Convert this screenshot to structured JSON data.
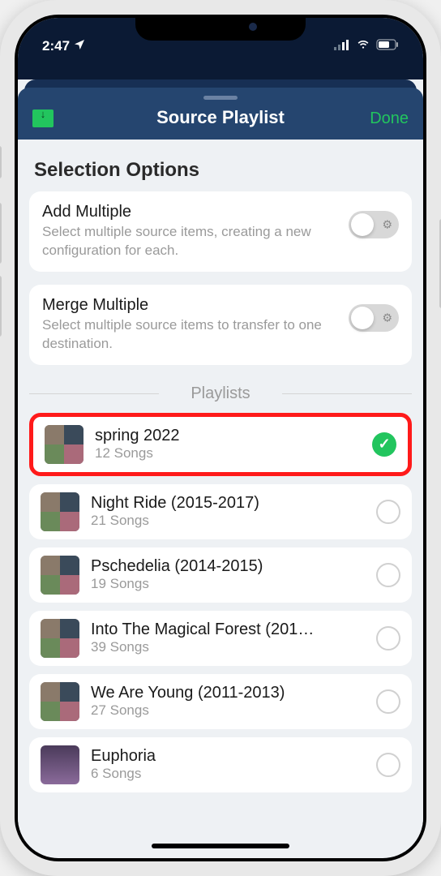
{
  "status": {
    "time": "2:47",
    "location_icon": "location-arrow"
  },
  "nav": {
    "title": "Source Playlist",
    "done": "Done"
  },
  "section_title": "Selection Options",
  "options": {
    "add": {
      "title": "Add Multiple",
      "desc": "Select multiple source items, creating a new configuration for each."
    },
    "merge": {
      "title": "Merge Multiple",
      "desc": "Select multiple source items to transfer to one destination."
    }
  },
  "playlists_header": "Playlists",
  "playlists": [
    {
      "name": "spring 2022",
      "sub": "12 Songs",
      "selected": true,
      "highlighted": true
    },
    {
      "name": "Night Ride (2015-2017)",
      "sub": "21 Songs",
      "selected": false
    },
    {
      "name": "Pschedelia (2014-2015)",
      "sub": "19 Songs",
      "selected": false
    },
    {
      "name": "Into The Magical Forest (201…",
      "sub": "39 Songs",
      "selected": false
    },
    {
      "name": "We Are Young (2011-2013)",
      "sub": "27 Songs",
      "selected": false
    },
    {
      "name": "Euphoria",
      "sub": "6 Songs",
      "selected": false,
      "single_art": true
    }
  ]
}
